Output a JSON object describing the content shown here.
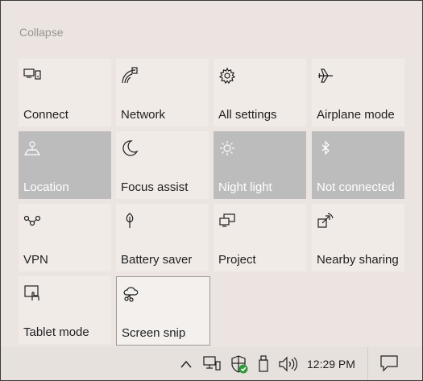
{
  "header": {
    "collapse_label": "Collapse"
  },
  "tiles": [
    {
      "label": "Connect",
      "icon": "connect-icon",
      "state": "off"
    },
    {
      "label": "Network",
      "icon": "network-icon",
      "state": "off"
    },
    {
      "label": "All settings",
      "icon": "gear-icon",
      "state": "off"
    },
    {
      "label": "Airplane mode",
      "icon": "airplane-icon",
      "state": "off"
    },
    {
      "label": "Location",
      "icon": "location-icon",
      "state": "on"
    },
    {
      "label": "Focus assist",
      "icon": "moon-icon",
      "state": "off"
    },
    {
      "label": "Night light",
      "icon": "sun-icon",
      "state": "on"
    },
    {
      "label": "Not connected",
      "icon": "bluetooth-icon",
      "state": "on"
    },
    {
      "label": "VPN",
      "icon": "vpn-icon",
      "state": "off"
    },
    {
      "label": "Battery saver",
      "icon": "battery-saver-icon",
      "state": "off"
    },
    {
      "label": "Project",
      "icon": "project-icon",
      "state": "off"
    },
    {
      "label": "Nearby sharing",
      "icon": "nearby-sharing-icon",
      "state": "off"
    },
    {
      "label": "Tablet mode",
      "icon": "tablet-mode-icon",
      "state": "off"
    },
    {
      "label": "Screen snip",
      "icon": "screen-snip-icon",
      "state": "focused"
    }
  ],
  "taskbar": {
    "clock": "12:29 PM",
    "icons": [
      "chevron-up-icon",
      "network-pc-icon",
      "defender-shield-icon",
      "usb-icon",
      "volume-icon",
      "notification-icon"
    ],
    "colors": {
      "shield_check": "#2e9b3a"
    }
  }
}
